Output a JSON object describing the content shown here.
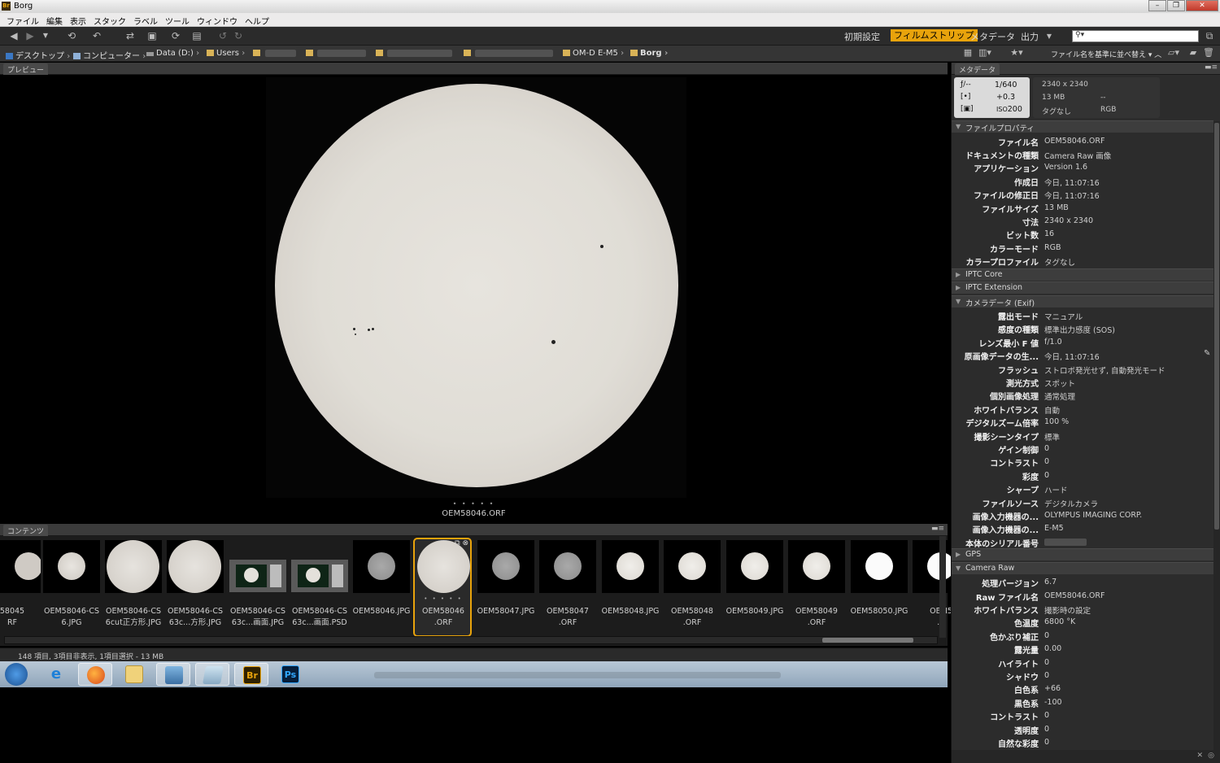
{
  "window": {
    "title": "Borg",
    "app_icon_text": "Br"
  },
  "menu": [
    "ファイル",
    "編集",
    "表示",
    "スタック",
    "ラベル",
    "ツール",
    "ウィンドウ",
    "ヘルプ"
  ],
  "toolbar": {
    "workspaces": [
      "初期設定",
      "フィルムストリップ",
      "メタデータ",
      "出力"
    ],
    "active_workspace": "フィルムストリップ",
    "search_placeholder": ""
  },
  "path": {
    "crumbs": [
      "デスクトップ",
      "コンピューター",
      "Data (D:)",
      "Users",
      "OM-D E-M5",
      "Borg"
    ],
    "sort_label": "ファイル名を基準に並べ替え"
  },
  "preview": {
    "tab": "プレビュー",
    "filename": "OEM58046.ORF"
  },
  "content": {
    "tab": "コンテンツ",
    "thumbnails": [
      {
        "label": "58045\nRF",
        "kind": "disc-partial"
      },
      {
        "label": "OEM58046-CS\n6.JPG",
        "kind": "disc-small"
      },
      {
        "label": "OEM58046-CS\n6cut正方形.JPG",
        "kind": "disc-full"
      },
      {
        "label": "OEM58046-CS\n63c...方形.JPG",
        "kind": "disc-full"
      },
      {
        "label": "OEM58046-CS\n63c...画面.JPG",
        "kind": "screen"
      },
      {
        "label": "OEM58046-CS\n63c...画面.PSD",
        "kind": "screen"
      },
      {
        "label": "OEM58046.JPG",
        "kind": "disc-gray"
      },
      {
        "label": "OEM58046\n.ORF",
        "kind": "disc-full",
        "selected": true
      },
      {
        "label": "OEM58047.JPG",
        "kind": "disc-gray"
      },
      {
        "label": "OEM58047\n.ORF",
        "kind": "disc-gray"
      },
      {
        "label": "OEM58048.JPG",
        "kind": "disc-bright"
      },
      {
        "label": "OEM58048\n.ORF",
        "kind": "disc-bright"
      },
      {
        "label": "OEM58049.JPG",
        "kind": "disc-bright"
      },
      {
        "label": "OEM58049\n.ORF",
        "kind": "disc-bright"
      },
      {
        "label": "OEM58050.JPG",
        "kind": "disc-white"
      },
      {
        "label": "OEM5\n.C",
        "kind": "disc-white"
      }
    ]
  },
  "status": {
    "text": "148 項目, 3項目非表示, 1項目選択 - 13 MB"
  },
  "metadata": {
    "tab": "メタデータ",
    "summary": {
      "aperture": "ƒ/--",
      "shutter": "1/640",
      "exposure_comp": "+0.3",
      "iso_label": "ISO",
      "iso": "200",
      "dimensions": "2340 x 2340",
      "size": "13 MB",
      "resolution": "--",
      "tag": "タグなし",
      "colormode": "RGB"
    },
    "sections": {
      "file_properties": "ファイルプロパティ",
      "iptc_core": "IPTC Core",
      "iptc_ext": "IPTC Extension",
      "camera_exif": "カメラデータ (Exif)",
      "gps": "GPS",
      "camera_raw": "Camera Raw"
    },
    "file_props": [
      {
        "k": "ファイル名",
        "v": "OEM58046.ORF"
      },
      {
        "k": "ドキュメントの種類",
        "v": "Camera Raw 画像"
      },
      {
        "k": "アプリケーション",
        "v": "Version 1.6"
      },
      {
        "k": "作成日",
        "v": "今日, 11:07:16"
      },
      {
        "k": "ファイルの修正日",
        "v": "今日, 11:07:16"
      },
      {
        "k": "ファイルサイズ",
        "v": "13 MB"
      },
      {
        "k": "寸法",
        "v": "2340 x 2340"
      },
      {
        "k": "ビット数",
        "v": "16"
      },
      {
        "k": "カラーモード",
        "v": "RGB"
      },
      {
        "k": "カラープロファイル",
        "v": "タグなし"
      }
    ],
    "exif": [
      {
        "k": "露出モード",
        "v": "マニュアル"
      },
      {
        "k": "感度の種類",
        "v": "標準出力感度 (SOS)"
      },
      {
        "k": "レンズ最小 F 値",
        "v": "f/1.0"
      },
      {
        "k": "原画像データの生...",
        "v": "今日, 11:07:16"
      },
      {
        "k": "フラッシュ",
        "v": "ストロボ発光せず, 自動発光モード"
      },
      {
        "k": "測光方式",
        "v": "スポット"
      },
      {
        "k": "個別画像処理",
        "v": "通常処理"
      },
      {
        "k": "ホワイトバランス",
        "v": "自動"
      },
      {
        "k": "デジタルズーム倍率",
        "v": "100 %"
      },
      {
        "k": "撮影シーンタイプ",
        "v": "標準"
      },
      {
        "k": "ゲイン制御",
        "v": "0"
      },
      {
        "k": "コントラスト",
        "v": "0"
      },
      {
        "k": "彩度",
        "v": "0"
      },
      {
        "k": "シャープ",
        "v": "ハード"
      },
      {
        "k": "ファイルソース",
        "v": "デジタルカメラ"
      },
      {
        "k": "画像入力機器の...",
        "v": "OLYMPUS IMAGING CORP."
      },
      {
        "k": "画像入力機器の...",
        "v": "E-M5"
      },
      {
        "k": "本体のシリアル番号",
        "v": ""
      }
    ],
    "raw": [
      {
        "k": "処理バージョン",
        "v": "6.7"
      },
      {
        "k": "Raw ファイル名",
        "v": "OEM58046.ORF"
      },
      {
        "k": "ホワイトバランス",
        "v": "撮影時の設定"
      },
      {
        "k": "色温度",
        "v": "6800 °K"
      },
      {
        "k": "色かぶり補正",
        "v": "0"
      },
      {
        "k": "露光量",
        "v": "0.00"
      },
      {
        "k": "ハイライト",
        "v": "0"
      },
      {
        "k": "シャドウ",
        "v": "0"
      },
      {
        "k": "白色系",
        "v": "+66"
      },
      {
        "k": "黒色系",
        "v": "-100"
      },
      {
        "k": "コントラスト",
        "v": "0"
      },
      {
        "k": "透明度",
        "v": "0"
      },
      {
        "k": "自然な彩度",
        "v": "0"
      }
    ]
  },
  "colors": {
    "accent": "#e8a30c",
    "panel": "#2c2c2c"
  }
}
